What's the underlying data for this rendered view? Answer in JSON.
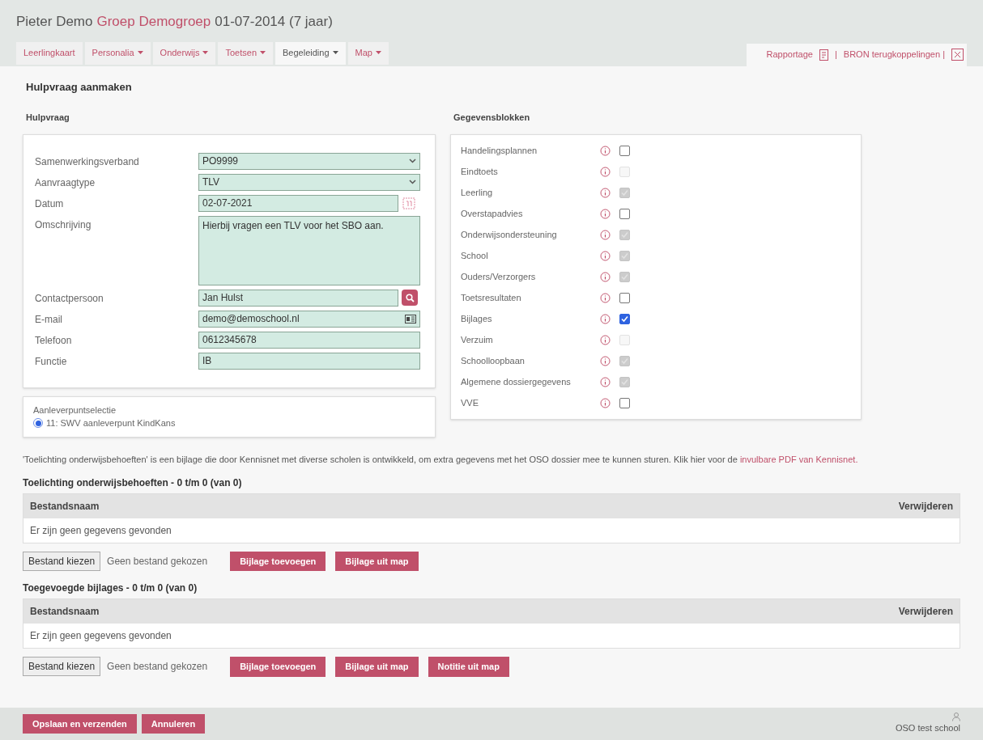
{
  "header": {
    "student": "Pieter Demo",
    "group": "Groep Demogroep",
    "birth": "01-07-2014 (7 jaar)"
  },
  "tabs": [
    {
      "label": "Leerlingkaart",
      "selected": false,
      "menu": false
    },
    {
      "label": "Personalia",
      "selected": false,
      "menu": true
    },
    {
      "label": "Onderwijs",
      "selected": false,
      "menu": true
    },
    {
      "label": "Toetsen",
      "selected": false,
      "menu": true
    },
    {
      "label": "Begeleiding",
      "selected": true,
      "menu": true
    },
    {
      "label": "Map",
      "selected": false,
      "menu": true
    }
  ],
  "top_links": {
    "report": "Rapportage",
    "separator": "|",
    "bron": "BRON terugkoppelingen |"
  },
  "page_title": "Hulpvraag aanmaken",
  "form": {
    "heading": "Hulpvraag",
    "fields": [
      {
        "kind": "select",
        "label": "Samenwerkingsverband",
        "value": "PO9999"
      },
      {
        "kind": "select",
        "label": "Aanvraagtype",
        "value": "TLV"
      },
      {
        "kind": "date",
        "label": "Datum",
        "value": "02-07-2021"
      },
      {
        "kind": "textarea",
        "label": "Omschrijving",
        "value": "Hierbij vragen een TLV voor het SBO aan."
      },
      {
        "kind": "search",
        "label": "Contactpersoon",
        "value": "Jan Hulst"
      },
      {
        "kind": "card",
        "label": "E-mail",
        "value": "demo@demoschool.nl"
      },
      {
        "kind": "text",
        "label": "Telefoon",
        "value": "0612345678"
      },
      {
        "kind": "text",
        "label": "Functie",
        "value": "IB"
      }
    ]
  },
  "delivery": {
    "label": "Aanleverpuntselectie",
    "options": [
      {
        "label": "11: SWV aanleverpunt KindKans",
        "selected": true
      }
    ]
  },
  "blocks": {
    "heading": "Gegevensblokken",
    "items": [
      {
        "label": "Handelingsplannen",
        "checked": false,
        "disabled": false
      },
      {
        "label": "Eindtoets",
        "checked": false,
        "disabled": true
      },
      {
        "label": "Leerling",
        "checked": true,
        "disabled": true
      },
      {
        "label": "Overstapadvies",
        "checked": false,
        "disabled": false
      },
      {
        "label": "Onderwijsondersteuning",
        "checked": true,
        "disabled": true
      },
      {
        "label": "School",
        "checked": true,
        "disabled": true
      },
      {
        "label": "Ouders/Verzorgers",
        "checked": true,
        "disabled": true
      },
      {
        "label": "Toetsresultaten",
        "checked": false,
        "disabled": false
      },
      {
        "label": "Bijlages",
        "checked": true,
        "disabled": false
      },
      {
        "label": "Verzuim",
        "checked": false,
        "disabled": true
      },
      {
        "label": "Schoolloopbaan",
        "checked": true,
        "disabled": true
      },
      {
        "label": "Algemene dossiergegevens",
        "checked": true,
        "disabled": true
      },
      {
        "label": "VVE",
        "checked": false,
        "disabled": false
      }
    ]
  },
  "info": {
    "text": "'Toelichting onderwijsbehoeften' is een bijlage die door Kennisnet met diverse scholen is ontwikkeld, om extra gegevens met het OSO dossier mee te kunnen sturen. Klik hier voor de",
    "link": "invulbare PDF van Kennisnet."
  },
  "sections": [
    {
      "title": "Toelichting onderwijsbehoeften - 0 t/m 0 (van 0)",
      "columns": [
        "Bestandsnaam",
        "Verwijderen"
      ],
      "empty": "Er zijn geen gegevens gevonden",
      "file_button": "Bestand kiezen",
      "file_status": "Geen bestand gekozen",
      "buttons": [
        "Bijlage toevoegen",
        "Bijlage uit map"
      ]
    },
    {
      "title": "Toegevoegde bijlages - 0 t/m 0 (van 0)",
      "columns": [
        "Bestandsnaam",
        "Verwijderen"
      ],
      "empty": "Er zijn geen gegevens gevonden",
      "file_button": "Bestand kiezen",
      "file_status": "Geen bestand gekozen",
      "buttons": [
        "Bijlage toevoegen",
        "Bijlage uit map",
        "Notitie uit map"
      ]
    }
  ],
  "footer": {
    "buttons": [
      "Opslaan en verzenden",
      "Annuleren"
    ],
    "school": "OSO test school"
  }
}
